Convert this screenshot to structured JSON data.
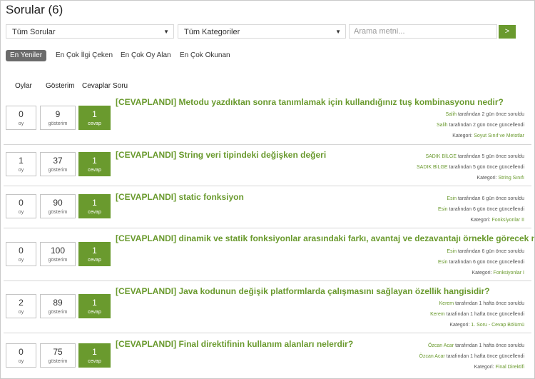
{
  "page_title": "Sorular (6)",
  "filters": {
    "questions_select": "Tüm Sorular",
    "categories_select": "Tüm Kategoriler",
    "search_placeholder": "Arama metni...",
    "go_label": ">"
  },
  "sort_tabs": [
    "En Yeniler",
    "En Çok İlgi Çeken",
    "En Çok Oy Alan",
    "En Çok Okunan"
  ],
  "columns": [
    "Oylar",
    "Gösterim",
    "Cevaplar",
    "Soru"
  ],
  "labels": {
    "votes": "oy",
    "views": "gösterim",
    "answers": "cevap"
  },
  "questions": [
    {
      "votes": "0",
      "views": "9",
      "answers": "1",
      "title": "[CEVAPLANDI] Metodu yazdıktan sonra tanımlamak için kullandığınız tuş kombinasyonu nedir?",
      "asked_by": "Salih",
      "asked_text": " tarafından 2 gün önce soruldu",
      "updated_by": "Salih",
      "updated_text": " tarafından 2 gün önce güncellendi",
      "category_label": "Kategori: ",
      "category": "Soyut Sınıf ve Metotlar"
    },
    {
      "votes": "1",
      "views": "37",
      "answers": "1",
      "title": "[CEVAPLANDI] String veri tipindeki değişken değeri",
      "asked_by": "SADIK BİLGE",
      "asked_text": " tarafından 5 gün önce soruldu",
      "updated_by": "SADIK BİLGE",
      "updated_text": " tarafından 5 gün önce güncellendi",
      "category_label": "Kategori: ",
      "category": "String Sınıfı"
    },
    {
      "votes": "0",
      "views": "90",
      "answers": "1",
      "title": "[CEVAPLANDI] static fonksiyon",
      "asked_by": "Esin",
      "asked_text": " tarafından 6 gün önce soruldu",
      "updated_by": "Esin",
      "updated_text": " tarafından 6 gün önce güncellendi",
      "category_label": "Kategori: ",
      "category": "Fonksiyonlar II"
    },
    {
      "votes": "0",
      "views": "100",
      "answers": "1",
      "title": "[CEVAPLANDI] dinamik ve statik fonksiyonlar arasındaki farkı, avantaj ve dezavantajı örnekle görecek miyiz?",
      "asked_by": "Esin",
      "asked_text": " tarafından 6 gün önce soruldu",
      "updated_by": "Esin",
      "updated_text": " tarafından 6 gün önce güncellendi",
      "category_label": "Kategori: ",
      "category": "Fonksiyonlar I"
    },
    {
      "votes": "2",
      "views": "89",
      "answers": "1",
      "title": "[CEVAPLANDI] Java kodunun değişik platformlarda çalışmasını sağlayan özellik hangisidir?",
      "asked_by": "Kerem",
      "asked_text": " tarafından 1 hafta önce soruldu",
      "updated_by": "Kerem",
      "updated_text": " tarafından 1 hafta önce güncellendi",
      "category_label": "Kategori: ",
      "category": "1. Soru - Cevap Bölümü"
    },
    {
      "votes": "0",
      "views": "75",
      "answers": "1",
      "title": "[CEVAPLANDI] Final direktifinin kullanım alanları nelerdir?",
      "asked_by": "Özcan Acar",
      "asked_text": " tarafından 1 hafta önce soruldu",
      "updated_by": "Özcan Acar",
      "updated_text": " tarafından 1 hafta önce güncellendi",
      "category_label": "Kategori: ",
      "category": "Final Direktifi"
    }
  ]
}
